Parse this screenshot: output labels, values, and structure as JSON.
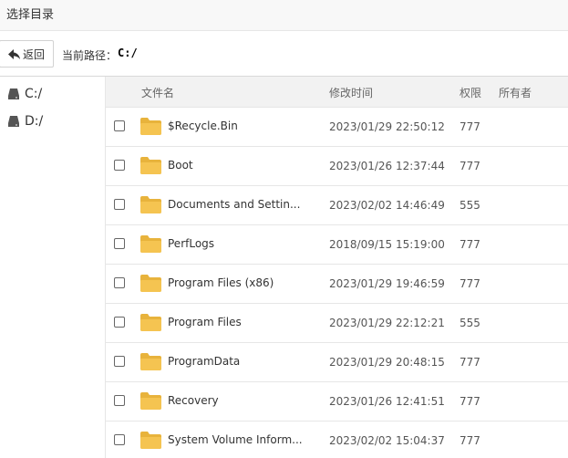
{
  "window": {
    "title": "选择目录"
  },
  "toolbar": {
    "back_label": "返回",
    "path_label": "当前路径：",
    "path_value": "C:/"
  },
  "sidebar": {
    "drives": [
      {
        "label": "C:/"
      },
      {
        "label": "D:/"
      }
    ]
  },
  "table": {
    "headers": {
      "name": "文件名",
      "mtime": "修改时间",
      "perm": "权限",
      "owner": "所有者"
    },
    "rows": [
      {
        "name": "$Recycle.Bin",
        "mtime": "2023/01/29 22:50:12",
        "perm": "777",
        "owner": ""
      },
      {
        "name": "Boot",
        "mtime": "2023/01/26 12:37:44",
        "perm": "777",
        "owner": ""
      },
      {
        "name": "Documents and Settin...",
        "mtime": "2023/02/02 14:46:49",
        "perm": "555",
        "owner": ""
      },
      {
        "name": "PerfLogs",
        "mtime": "2018/09/15 15:19:00",
        "perm": "777",
        "owner": ""
      },
      {
        "name": "Program Files (x86)",
        "mtime": "2023/01/29 19:46:59",
        "perm": "777",
        "owner": ""
      },
      {
        "name": "Program Files",
        "mtime": "2023/01/29 22:12:21",
        "perm": "555",
        "owner": ""
      },
      {
        "name": "ProgramData",
        "mtime": "2023/01/29 20:48:15",
        "perm": "777",
        "owner": ""
      },
      {
        "name": "Recovery",
        "mtime": "2023/01/26 12:41:51",
        "perm": "777",
        "owner": ""
      },
      {
        "name": "System Volume Inform...",
        "mtime": "2023/02/02 15:04:37",
        "perm": "777",
        "owner": ""
      }
    ]
  },
  "icons": {
    "back": "back-arrow-icon",
    "drive": "hard-drive-icon",
    "folder": "folder-icon",
    "checkbox": "checkbox"
  },
  "colors": {
    "folder": "#f5c451",
    "folder_back": "#e8b33c",
    "header_bg": "#f2f2f2",
    "title_bg": "#f8f8f8"
  }
}
